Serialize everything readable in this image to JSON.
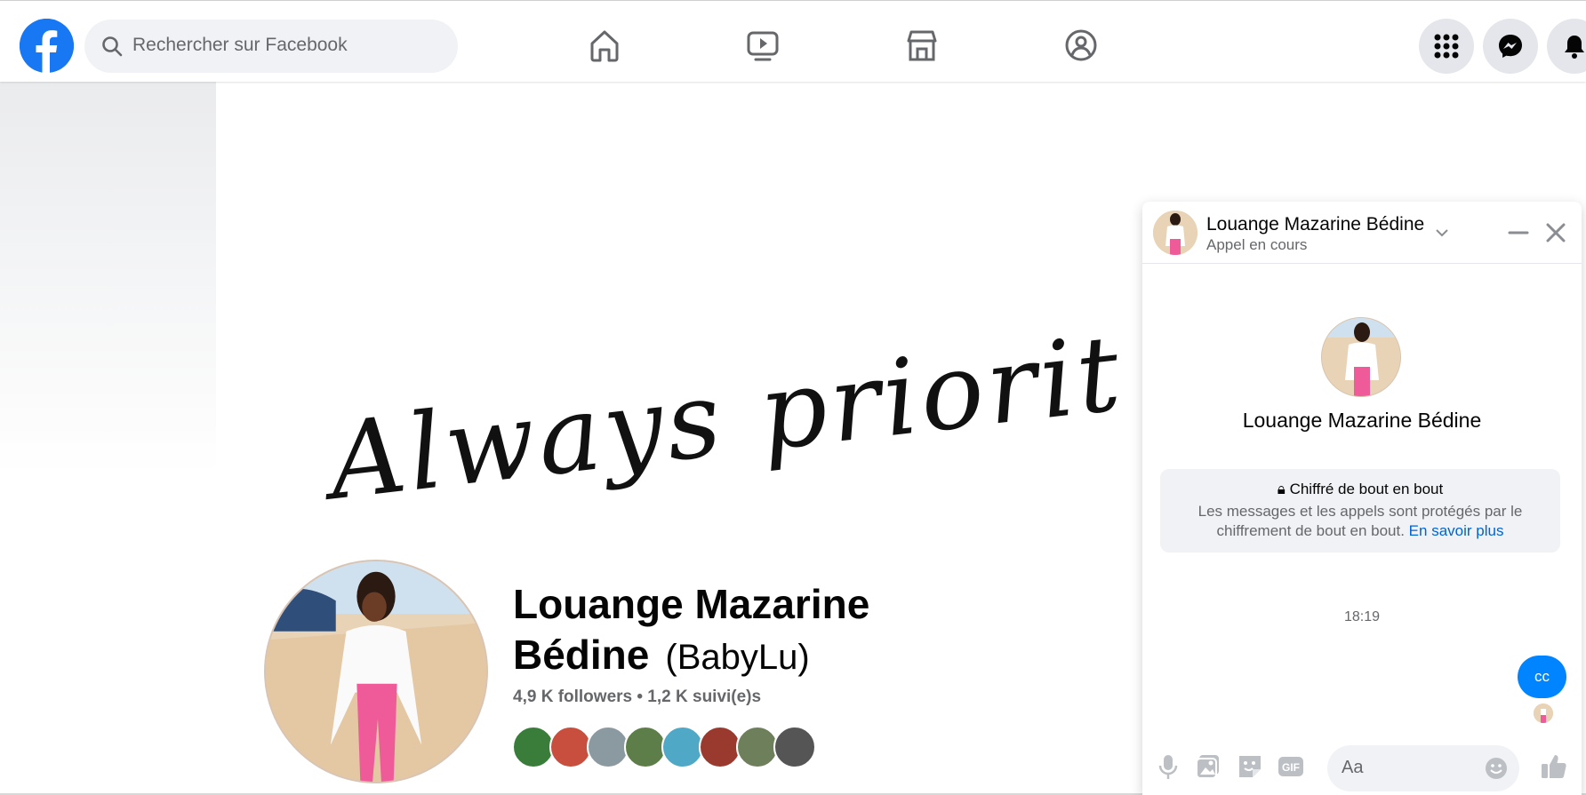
{
  "topbar": {
    "search_placeholder": "Rechercher sur Facebook",
    "nav_icons": [
      "home-icon",
      "watch-icon",
      "marketplace-icon",
      "groups-icon"
    ],
    "right_buttons": [
      "menu-grid-icon",
      "messenger-icon",
      "notifications-icon"
    ]
  },
  "cover": {
    "text": "Always priorit"
  },
  "profile": {
    "name": "Louange Mazarine Bédine",
    "alternate_name": "(BabyLu)",
    "stats": "4,9 K followers • 1,2 K suivi(e)s",
    "friend_avatars_count": 8
  },
  "chat": {
    "name": "Louange Mazarine Bédine",
    "status": "Appel en cours",
    "center_name": "Louange Mazarine Bédine",
    "e2e_title": "Chiffré de bout en bout",
    "e2e_desc": "Les messages et les appels sont protégés par le chiffrement de bout en bout.",
    "e2e_link": "En savoir plus",
    "time": "18:19",
    "message": "cc",
    "input_placeholder": "Aa"
  },
  "colors": {
    "brand": "#1877f2",
    "bubble": "#0084ff",
    "link": "#0064d1",
    "secondary_text": "#65676b"
  }
}
